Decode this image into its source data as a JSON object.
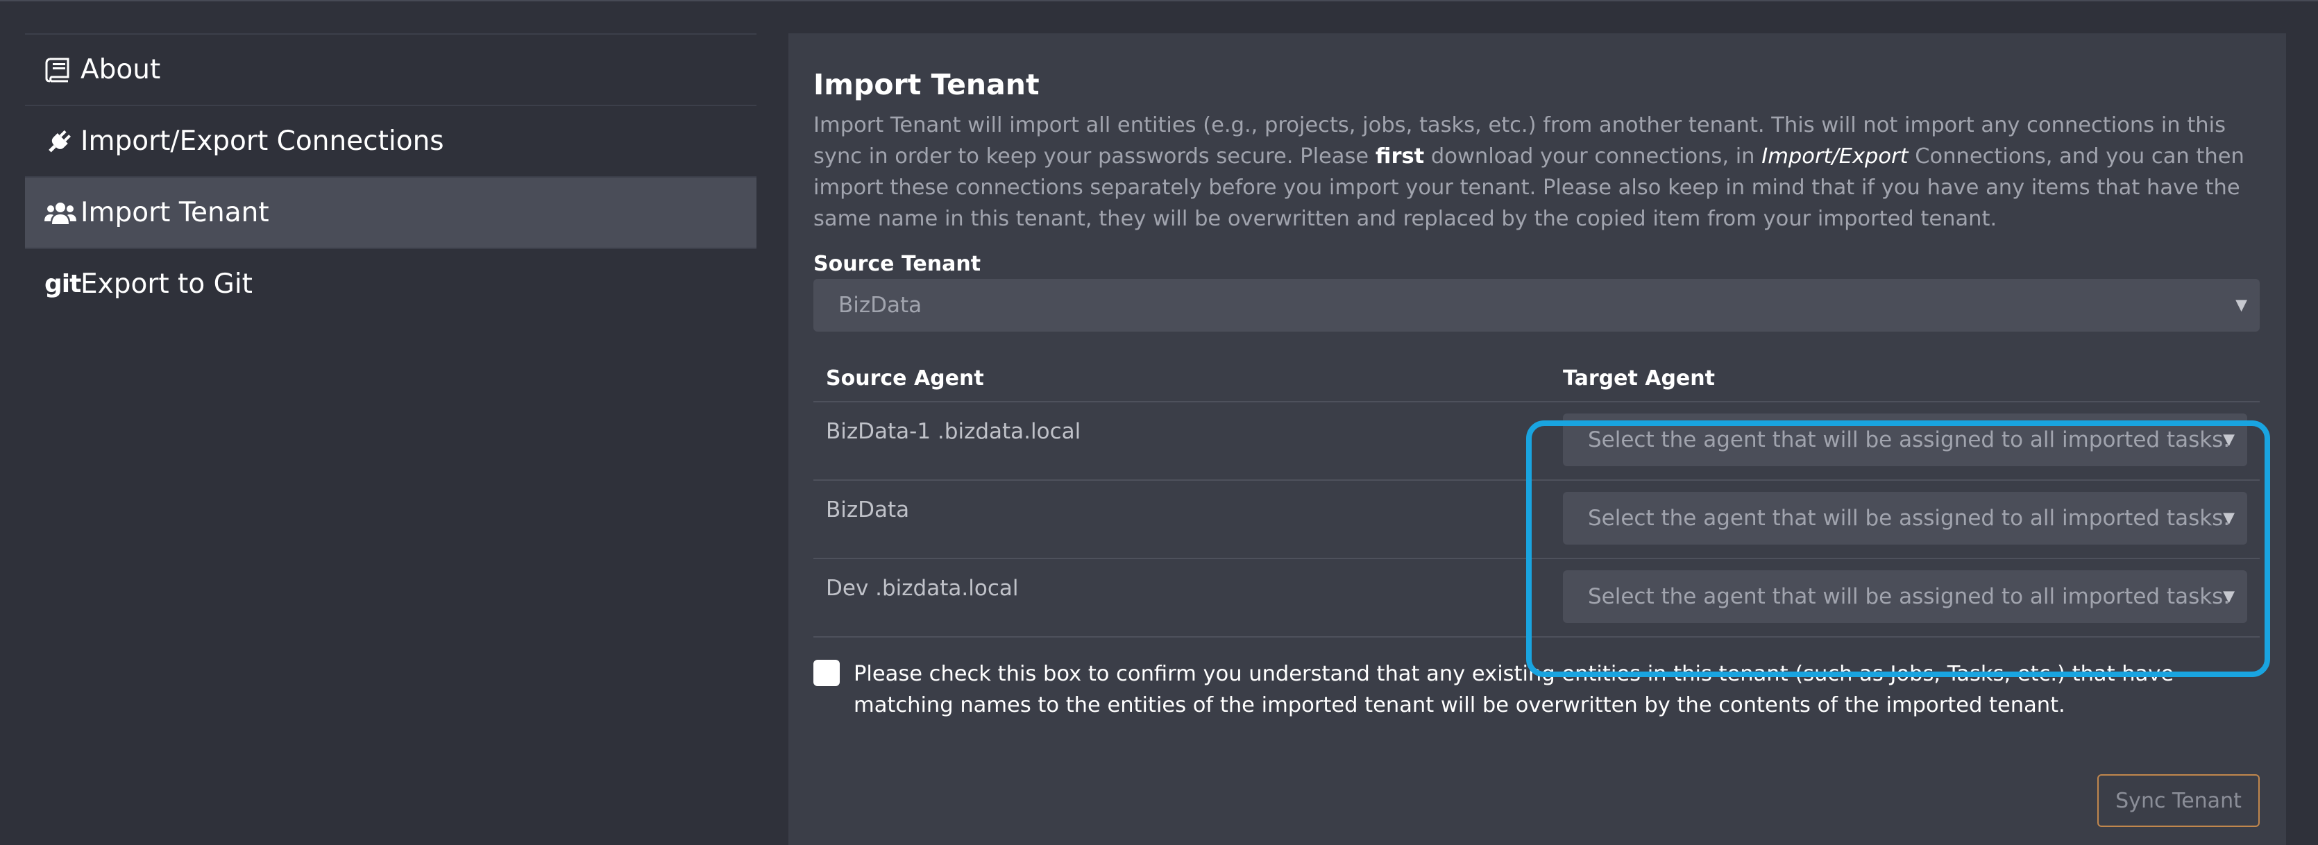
{
  "sidebar": {
    "items": [
      {
        "label": "About",
        "icon": "book-icon"
      },
      {
        "label": "Import/Export Connections",
        "icon": "plug-icon"
      },
      {
        "label": "Import Tenant",
        "icon": "users-icon",
        "active": true
      },
      {
        "label": "Export to Git",
        "icon": "git-icon",
        "icon_text": "git"
      }
    ]
  },
  "main": {
    "title": "Import Tenant",
    "description": {
      "part1": "Import Tenant will import all entities (e.g., projects, jobs, tasks, etc.) from another tenant. This will not import any connections in this sync in order to keep your passwords secure. Please ",
      "bold": "first",
      "part2": " download your connections, in ",
      "italic": "Import/Export",
      "part3": " Connections, and you can then import these connections separately before you import your tenant. Please also keep in mind that if you have any items that have the same name in this tenant, they will be overwritten and replaced by the copied item from your imported tenant."
    },
    "source_tenant": {
      "label": "Source Tenant",
      "value": "BizData"
    },
    "agents": {
      "headers": {
        "source": "Source Agent",
        "target": "Target Agent"
      },
      "rows": [
        {
          "source": "BizData-1 .bizdata.local",
          "target_placeholder": "Select the agent that will be assigned to all imported tasks."
        },
        {
          "source": "BizData",
          "target_placeholder": "Select the agent that will be assigned to all imported tasks."
        },
        {
          "source": "Dev .bizdata.local",
          "target_placeholder": "Select the agent that will be assigned to all imported tasks."
        }
      ]
    },
    "confirm_text": "Please check this box to confirm you understand that any existing entities in this tenant (such as Jobs, Tasks, etc.) that have matching names to the entities of the imported tenant will be overwritten by the contents of the imported tenant.",
    "sync_button": "Sync Tenant"
  },
  "colors": {
    "background": "#2f313a",
    "panel": "#3b3e48",
    "highlight": "#19a4e0",
    "button_border": "#c1874d"
  }
}
